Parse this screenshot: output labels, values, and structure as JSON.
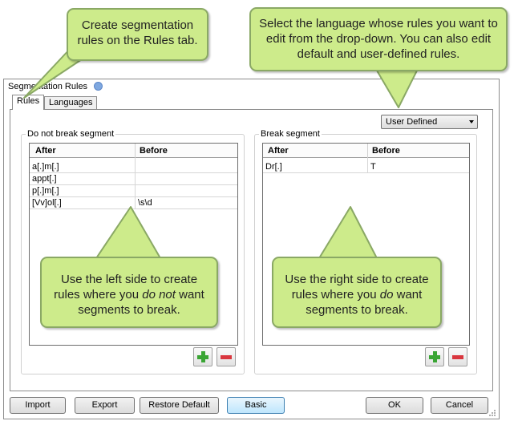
{
  "dialog": {
    "title": "Segmentation Rules",
    "tabs": [
      {
        "label": "Rules",
        "active": true
      },
      {
        "label": "Languages",
        "active": false
      }
    ],
    "language_select": {
      "value": "User Defined"
    }
  },
  "left_group": {
    "label": "Do not break segment",
    "columns": [
      "After",
      "Before"
    ],
    "rows": [
      {
        "after": "a[.]m[.]",
        "before": ""
      },
      {
        "after": "appt[.]",
        "before": ""
      },
      {
        "after": "p[.]m[.]",
        "before": ""
      },
      {
        "after": "[Vv]ol[.]",
        "before": "\\s\\d"
      }
    ]
  },
  "right_group": {
    "label": "Break segment",
    "columns": [
      "After",
      "Before"
    ],
    "rows": [
      {
        "after": "Dr[.]",
        "before": "T"
      }
    ]
  },
  "buttons": {
    "import": "Import",
    "export": "Export",
    "restore_default": "Restore Default",
    "basic": "Basic",
    "ok": "OK",
    "cancel": "Cancel"
  },
  "icons": {
    "info": "info-icon",
    "add": "plus-icon",
    "remove": "minus-icon",
    "dropdown": "chevron-down-icon"
  },
  "callouts": {
    "rules_tab": "Create segmentation rules on the Rules tab.",
    "language": "Select the language whose rules you want to edit from the drop-down. You can also edit default and user-defined rules.",
    "left_side_pre": "Use the left side to create rules where you ",
    "left_side_em": "do not",
    "left_side_post": " want segments to break.",
    "right_side_pre": "Use the right side to create rules where you ",
    "right_side_em": "do",
    "right_side_post": " want segments to break."
  },
  "colors": {
    "callout_fill": "#cdeb8b",
    "callout_border": "#8aa865",
    "add_green": "#3aa534",
    "remove_red": "#d9363e"
  }
}
